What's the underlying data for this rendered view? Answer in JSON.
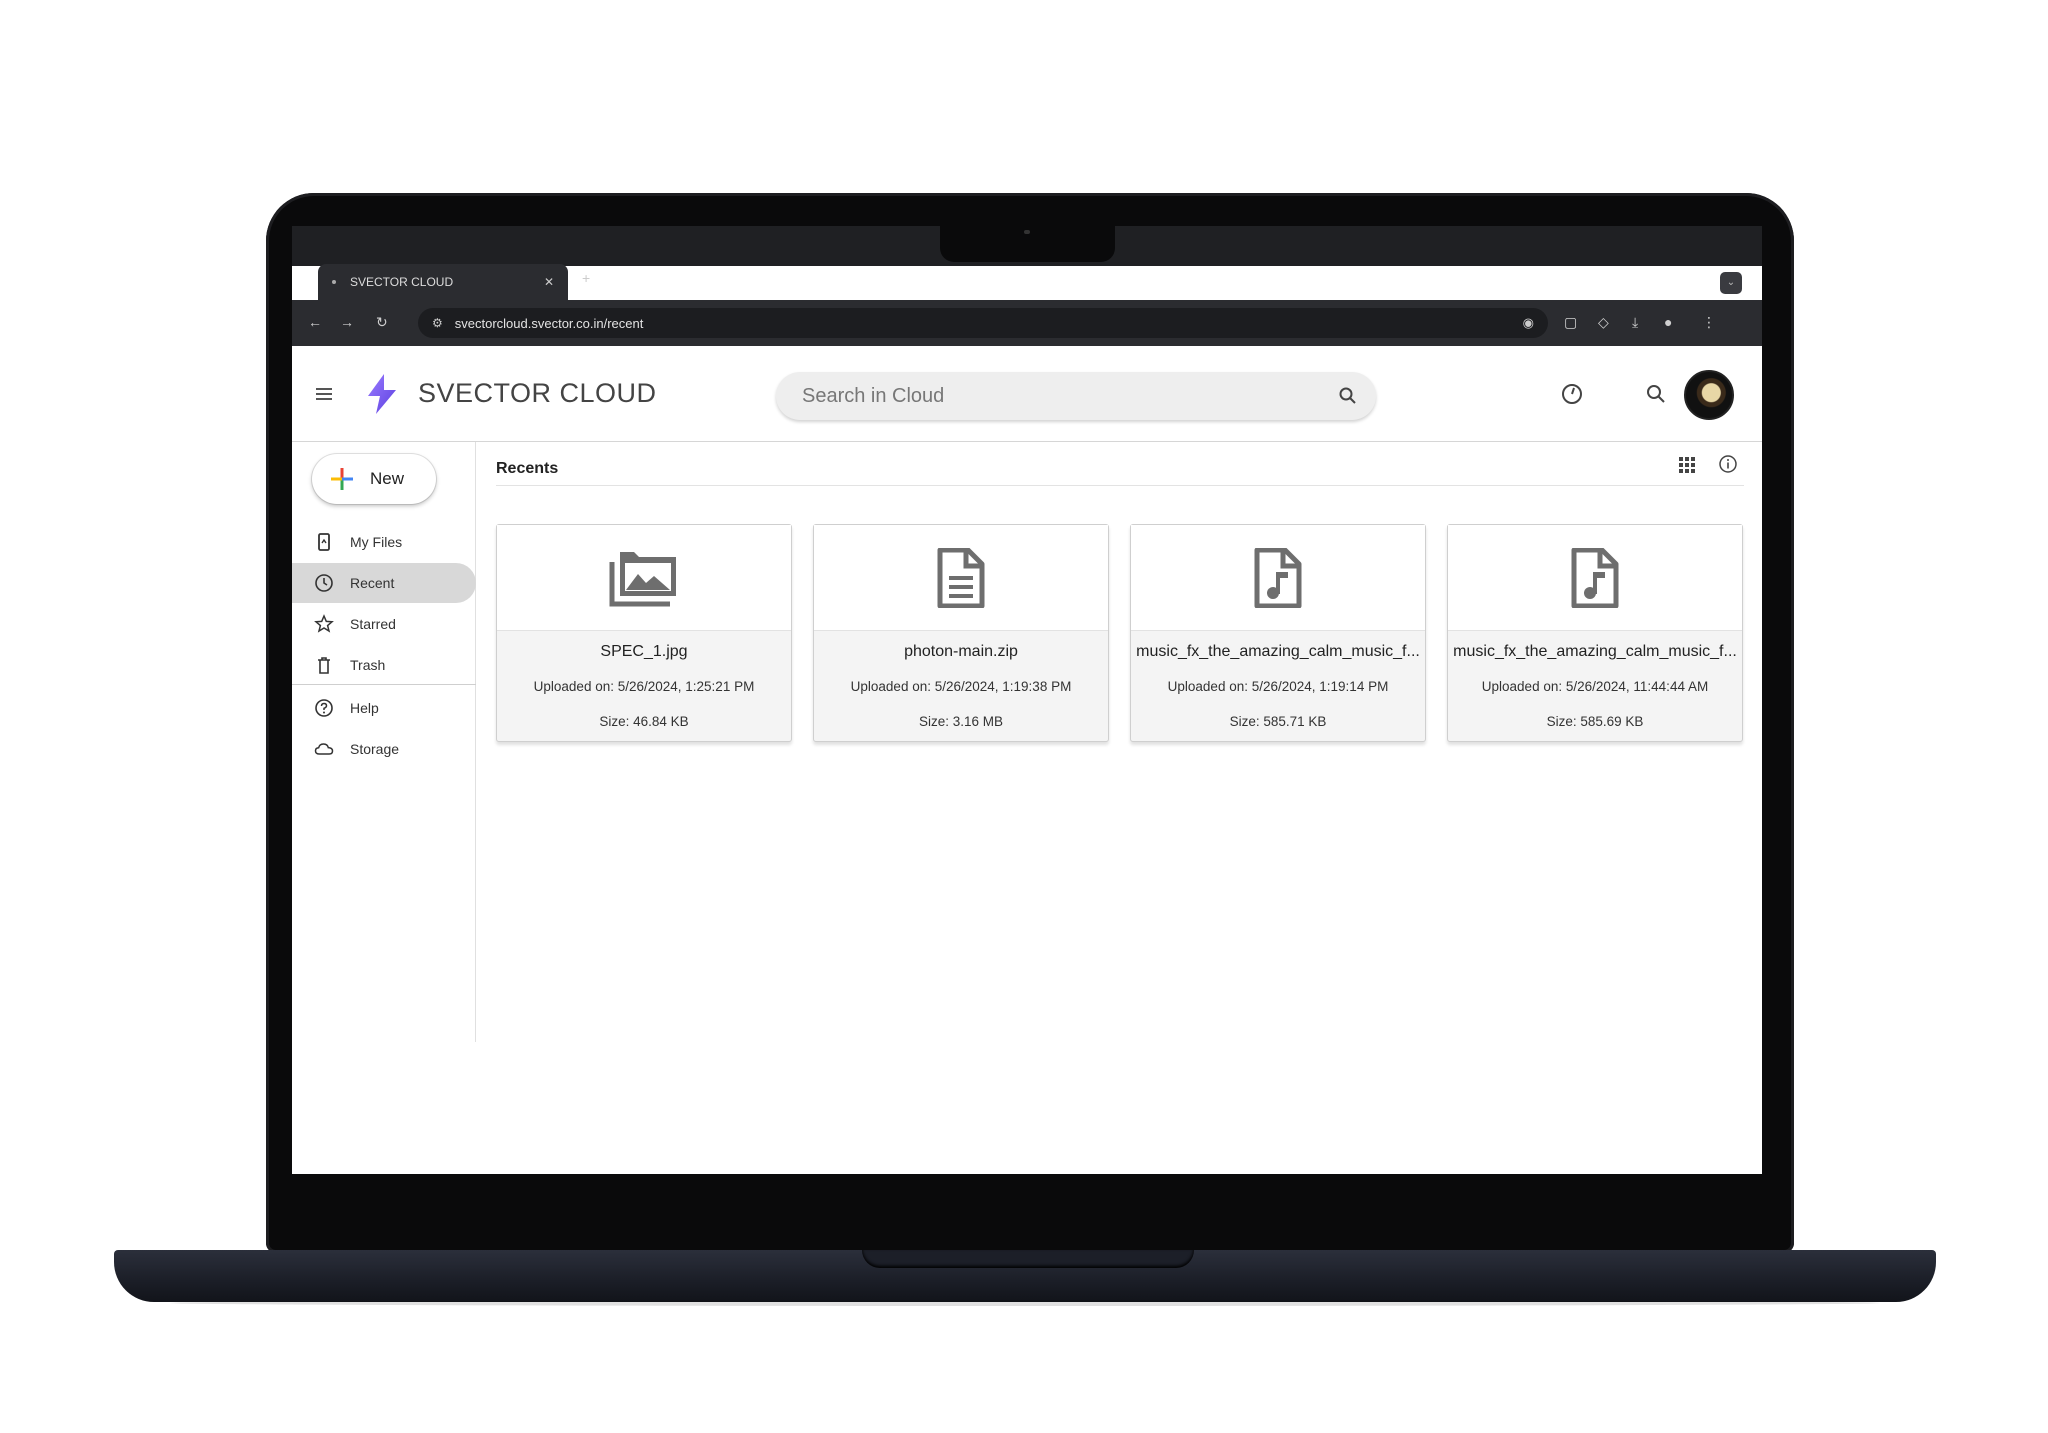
{
  "browser": {
    "tab_title": "SVECTOR CLOUD",
    "url": "svectorcloud.svector.co.in/recent"
  },
  "app": {
    "brand": "SVECTOR CLOUD",
    "search_placeholder": "Search in Cloud"
  },
  "sidebar": {
    "new_label": "New",
    "items": [
      {
        "label": "My Files",
        "icon": "phone-icon"
      },
      {
        "label": "Recent",
        "icon": "clock-icon",
        "active": true
      },
      {
        "label": "Starred",
        "icon": "star-icon"
      },
      {
        "label": "Trash",
        "icon": "trash-icon"
      },
      {
        "label": "Help",
        "icon": "help-icon"
      },
      {
        "label": "Storage",
        "icon": "cloud-icon"
      }
    ]
  },
  "main": {
    "section_title": "Recents",
    "files": [
      {
        "name": "SPEC_1.jpg",
        "uploaded": "Uploaded on: 5/26/2024, 1:25:21 PM",
        "size": "Size: 46.84 KB",
        "icon": "image-icon"
      },
      {
        "name": "photon-main.zip",
        "uploaded": "Uploaded on: 5/26/2024, 1:19:38 PM",
        "size": "Size: 3.16 MB",
        "icon": "document-icon"
      },
      {
        "name": "music_fx_the_amazing_calm_music_f...",
        "uploaded": "Uploaded on: 5/26/2024, 1:19:14 PM",
        "size": "Size: 585.71 KB",
        "icon": "audio-file-icon"
      },
      {
        "name": "music_fx_the_amazing_calm_music_f...",
        "uploaded": "Uploaded on: 5/26/2024, 11:44:44 AM",
        "size": "Size: 585.69 KB",
        "icon": "audio-file-icon"
      }
    ]
  },
  "colors": {
    "brand_purple": "#7c5cf0",
    "active_nav_bg": "#d8d8d8",
    "chrome_dark": "#2b2c30"
  }
}
